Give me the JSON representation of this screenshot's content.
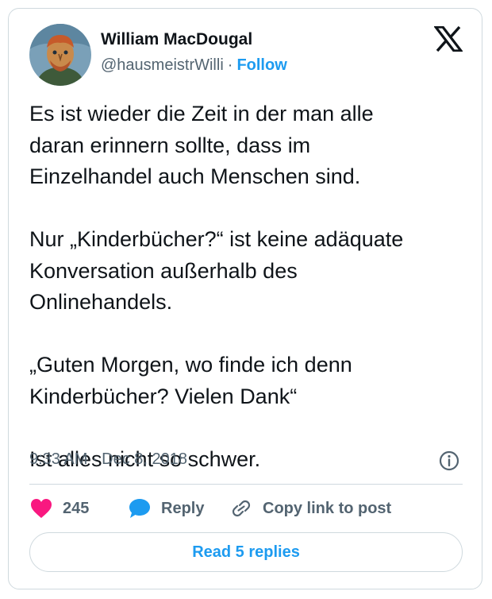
{
  "author": {
    "name": "William MacDougal",
    "handle": "@hausmeistrWilli",
    "separator": "·",
    "follow_label": "Follow"
  },
  "tweet": {
    "paragraphs": [
      [
        "Es ist wieder die Zeit in der man alle",
        "daran erinnern sollte, dass im",
        "Einzelhandel auch Menschen sind."
      ],
      [
        "Nur „Kinderbücher?“ ist keine adäquate",
        "Konversation außerhalb des",
        "Onlinehandels."
      ],
      [
        "„Guten Morgen, wo finde ich denn",
        "Kinderbücher? Vielen Dank“"
      ],
      [
        "Ist alles nicht so schwer."
      ]
    ],
    "timestamp": "9:33 AM · Dec 8, 2018"
  },
  "actions": {
    "like_count": "245",
    "reply_label": "Reply",
    "copy_link_label": "Copy link to post"
  },
  "read_replies_label": "Read 5 replies",
  "icons": {
    "logo": "x-logo-icon",
    "info": "info-icon",
    "like": "heart-icon",
    "reply": "speech-bubble-icon",
    "copy": "link-icon"
  },
  "colors": {
    "accent": "#1d9bf0",
    "heart": "#f91880",
    "text": "#0f1419",
    "muted": "#536471",
    "border": "#cfd9de"
  }
}
